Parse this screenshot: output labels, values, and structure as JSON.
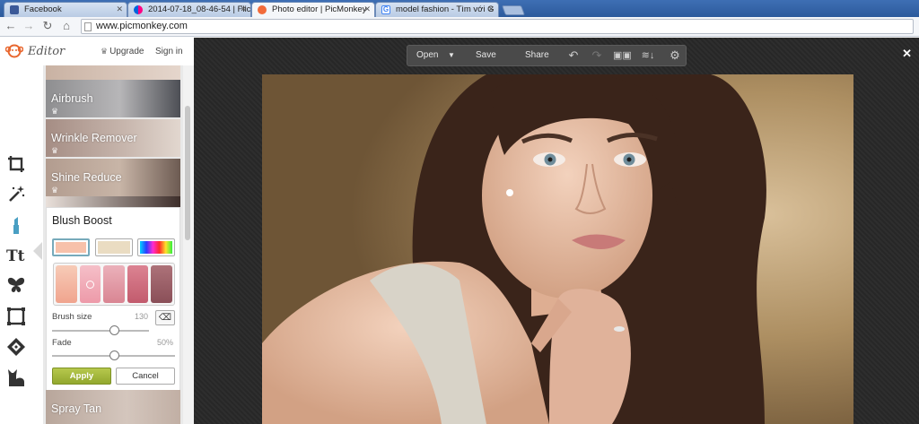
{
  "browser": {
    "tabs": [
      {
        "label": "Facebook",
        "favicon": "facebook-icon",
        "color": "#3b5998"
      },
      {
        "label": "2014-07-18_08-46-54 | Flic",
        "favicon": "flickr-icon",
        "color": "#ff0084"
      },
      {
        "label": "Photo editor | PicMonkey",
        "favicon": "picmonkey-icon",
        "color": "#f26b3a",
        "active": true
      },
      {
        "label": "model fashion - Tìm với G",
        "favicon": "google-icon",
        "color": "#4285f4"
      }
    ],
    "url": "www.picmonkey.com"
  },
  "app": {
    "brand": "Editor",
    "upgrade_label": "Upgrade",
    "signin_label": "Sign in",
    "tools": [
      "crop-icon",
      "magic-wand-icon",
      "lipstick-icon",
      "text-icon",
      "butterfly-icon",
      "frame-icon",
      "texture-icon",
      "cat-icon"
    ],
    "touchups": {
      "top_items": [
        {
          "label": "Airbrush",
          "tone": "#8b9098"
        },
        {
          "label": "Wrinkle Remover",
          "tone": "#a99389"
        },
        {
          "label": "Shine Reduce",
          "tone": "#b8a59a"
        }
      ],
      "bottom_item": {
        "label": "Spray Tan",
        "tone": "#b9a89c"
      }
    },
    "blush": {
      "title": "Blush Boost",
      "swatches": [
        "#f7c1aa",
        "#eadcc2",
        "rainbow"
      ],
      "palette": [
        "#f4b59e",
        "#f1a8b3",
        "#e39aa6",
        "#cc6b7b",
        "#985e66"
      ],
      "brush_label": "Brush size",
      "brush_value": "130",
      "brush_level": 0.64,
      "fade_label": "Fade",
      "fade_value": "50%",
      "fade_level": 0.5,
      "apply_label": "Apply",
      "cancel_label": "Cancel"
    },
    "toolbar": {
      "open_label": "Open",
      "save_label": "Save",
      "share_label": "Share"
    },
    "accent": "#a4b83b"
  }
}
